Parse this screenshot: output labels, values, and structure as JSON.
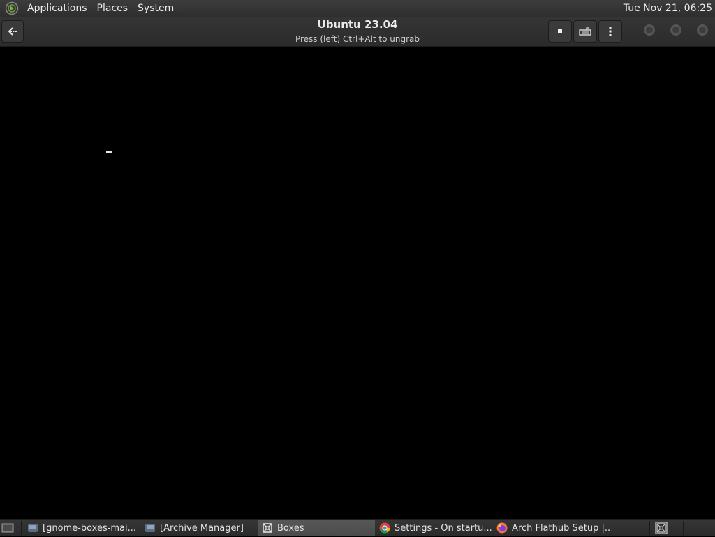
{
  "top_panel": {
    "menus": [
      "Applications",
      "Places",
      "System"
    ],
    "clock": "Tue Nov 21, 06:25"
  },
  "header": {
    "title": "Ubuntu 23.04",
    "subtitle": "Press (left) Ctrl+Alt to ungrab",
    "icons": [
      "back-arrow-icon",
      "stop-icon",
      "keyboard-icon",
      "kebab-menu-icon"
    ]
  },
  "taskbar": {
    "tasks": [
      {
        "label": "[gnome-boxes-mai...",
        "icon": "file-manager-icon"
      },
      {
        "label": "[Archive Manager]",
        "icon": "archive-manager-icon"
      },
      {
        "label": "Boxes",
        "icon": "boxes-icon",
        "active": true
      },
      {
        "label": "Settings - On startu...",
        "icon": "chrome-icon"
      },
      {
        "label": "Arch Flathub Setup |...",
        "icon": "firefox-icon"
      }
    ]
  },
  "colors": {
    "panel": "#2e2e2e",
    "vm_background": "#000000",
    "active_task": "#555555"
  }
}
